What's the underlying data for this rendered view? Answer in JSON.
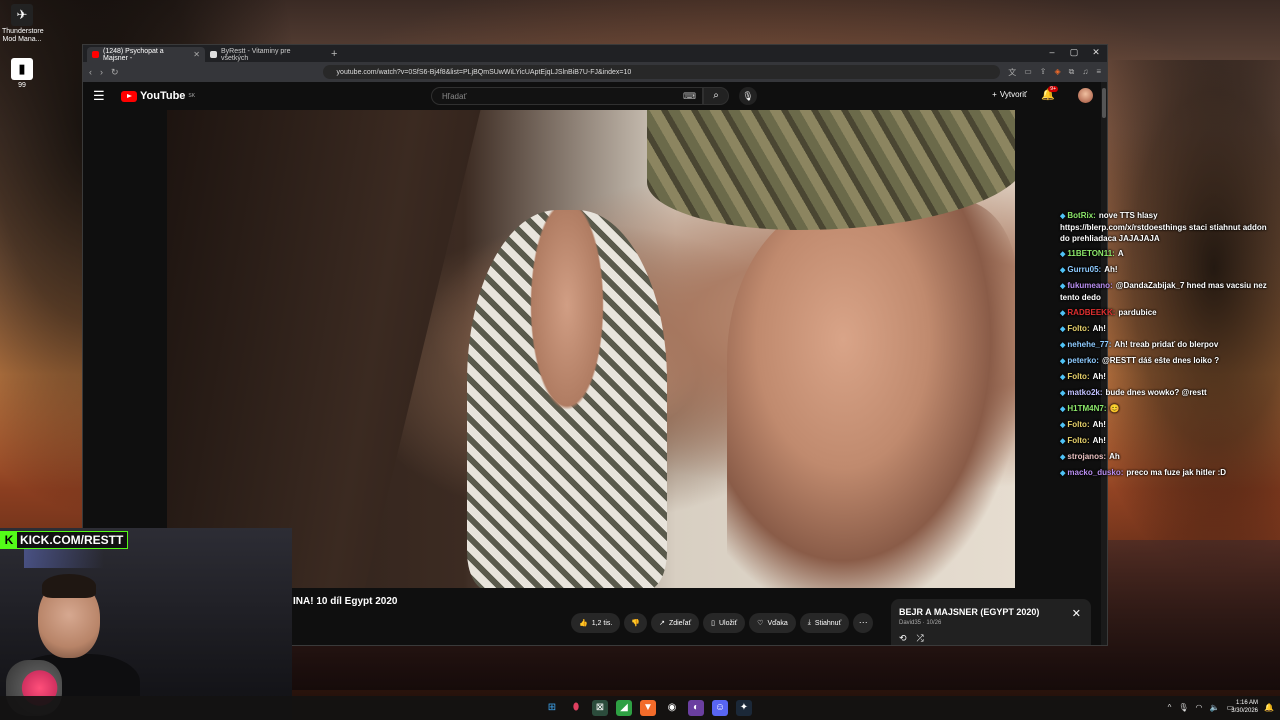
{
  "desktop": {
    "icons": [
      {
        "label": "Thunderstore Mod Mana...",
        "icon": "thunderstore-icon"
      },
      {
        "label": "99",
        "icon": "app-icon"
      }
    ]
  },
  "browser": {
    "tabs": [
      {
        "label": "(1248) Psychopat a Majsner -",
        "active": true
      },
      {
        "label": "ByRestt - Vitaminy pre všetkých",
        "active": false
      }
    ],
    "new_tab": "+",
    "window_controls": [
      "–",
      "▢",
      "✕"
    ],
    "url": "youtube.com/watch?v=0SfS6-Bj4f8&list=PLjBQmSUwWiLYicUAptEjqLJSlnBiB7U-FJ&index=10"
  },
  "youtube": {
    "logo": "YouTube",
    "region": "SK",
    "search_placeholder": "Hľadať",
    "create_label": "Vytvoriť",
    "notif_badge": "9+",
    "video_title": "INA! 10 díl Egypt 2020",
    "actions": {
      "like": "1,2 tis.",
      "share": "Zdieľať",
      "save": "Uložiť",
      "thanks": "Vďaka",
      "download": "Stiahnuť"
    },
    "playlist": {
      "title": "BEJR A MAJSNER (EGYPT 2020)",
      "sub": "David35 · 10/26"
    }
  },
  "chat": [
    {
      "user": "BotRix",
      "color": "#8de86b",
      "text": "nove TTS hlasy https://blerp.com/x/rstdoesthings staci stiahnut addon do prehliadaca JAJAJAJA"
    },
    {
      "user": "11BETON11",
      "color": "#8de86b",
      "text": "A"
    },
    {
      "user": "Gurru05",
      "color": "#8ecbff",
      "text": "Ah!"
    },
    {
      "user": "fukumeano",
      "color": "#b88ef0",
      "text": "@DandaZabijak_7 hned mas vacsiu nez tento dedo"
    },
    {
      "user": "RADBEEKK",
      "color": "#e03030",
      "text": "pardubice"
    },
    {
      "user": "Folto",
      "color": "#e8d26b",
      "text": "Ah!"
    },
    {
      "user": "nehehe_77",
      "color": "#8ecbff",
      "text": "Ah! treab pridať do blerpov"
    },
    {
      "user": "peterko",
      "color": "#8ecbff",
      "text": "@RESTT dáš ešte dnes loiko ?"
    },
    {
      "user": "Folto",
      "color": "#e8d26b",
      "text": "Ah!"
    },
    {
      "user": "matko2k",
      "color": "#c0c0ff",
      "text": "bude dnes wowko? @restt"
    },
    {
      "user": "H1TM4N7",
      "color": "#8de86b",
      "text": "😊"
    },
    {
      "user": "Folto",
      "color": "#e8d26b",
      "text": "Ah!"
    },
    {
      "user": "Folto",
      "color": "#e8d26b",
      "text": "Ah!"
    },
    {
      "user": "strojanos",
      "color": "#e8c0c0",
      "text": "Ah"
    },
    {
      "user": "macko_dusko",
      "color": "#b88ef0",
      "text": "preco ma fuze jak hitler :D"
    }
  ],
  "overlay": {
    "kick_label": "KICK.COM/RESTT",
    "kick_letter": "K"
  },
  "taskbar": {
    "time": "1:16 AM",
    "date": "3/30/2026"
  }
}
